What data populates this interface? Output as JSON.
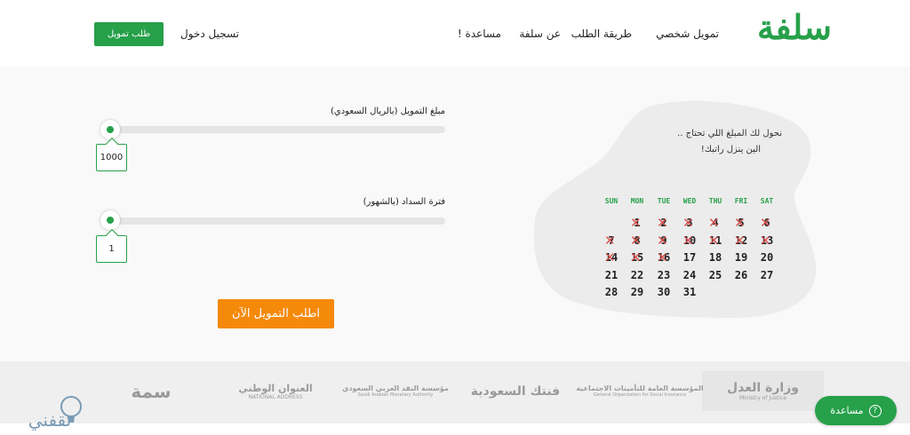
{
  "header": {
    "logo": "سلفة",
    "nav": [
      "تمويل شخصي",
      "طريقة الطلب",
      "عن سلفة",
      "مساعدة !"
    ],
    "login": "تسجيل دخول",
    "request_button": "طلب تمويل"
  },
  "calculator": {
    "amount_label": "مبلغ التمويل (بالريال السعودي)",
    "amount_value": "1000",
    "amount_level": 0,
    "period_label": "فترة السداد (بالشهور)",
    "period_value": "1",
    "period_level": 0,
    "cta": "اطلب التمويل الآن"
  },
  "promo": {
    "line1": "نحول لك المبلغ اللي تحتاج ..",
    "line2": "الين ينزل راتبك!",
    "weekdays": [
      "SUN",
      "MON",
      "TUE",
      "WED",
      "THU",
      "FRI",
      "SAT"
    ],
    "weeks": [
      [
        "",
        "1",
        "2",
        "3",
        "4",
        "5",
        "6"
      ],
      [
        "7",
        "8",
        "9",
        "10",
        "11",
        "12",
        "13"
      ],
      [
        "14",
        "15",
        "16",
        "17",
        "18",
        "19",
        "20"
      ],
      [
        "21",
        "22",
        "23",
        "24",
        "25",
        "26",
        "27"
      ],
      [
        "28",
        "29",
        "30",
        "31",
        "",
        "",
        ""
      ]
    ],
    "crossed_through": "16",
    "cross_color": "#d9534f"
  },
  "partners": [
    {
      "name": "وزارة العدل",
      "sub": "Ministry of Justice"
    },
    {
      "name": "المؤسسة العامة للتأمينات الاجتماعية",
      "sub": "General Organization for Social Insurance"
    },
    {
      "name": "فنتك السعودية",
      "sub": ""
    },
    {
      "name": "مؤسسة النقد العربي السعودي",
      "sub": "Saudi Arabian Monetary Authority"
    },
    {
      "name": "العنوان الوطني",
      "sub": "NATIONAL ADDRESS"
    },
    {
      "name": "سمة",
      "sub": ""
    }
  ],
  "help_button": "مساعدة",
  "help_icon": "question-circle-icon",
  "watermark": "ثقفني",
  "colors": {
    "brand_green": "#27a04a",
    "cta_orange": "#f5890a",
    "band_bg": "#f9f9f9",
    "blob": "#ececec"
  }
}
